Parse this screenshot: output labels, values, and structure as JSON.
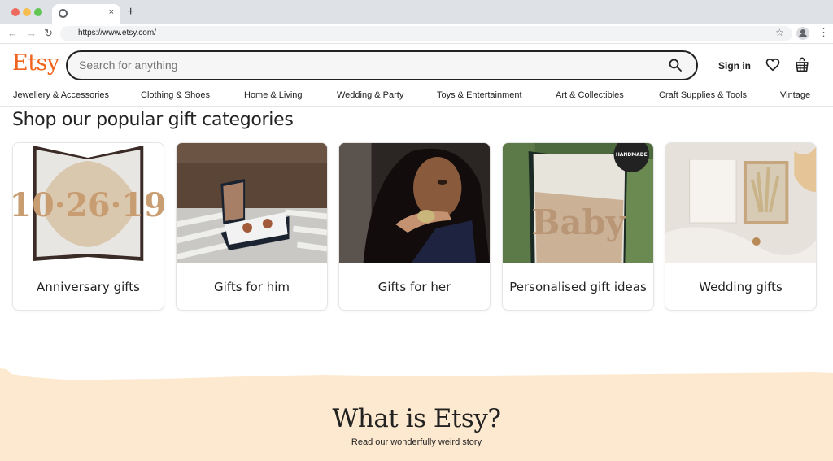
{
  "browser": {
    "tab_close": "×",
    "new_tab": "+",
    "url": "https://www.etsy.com/",
    "back": "←",
    "forward": "→",
    "reload": "↻",
    "bookmark": "☆",
    "menu": "⋮"
  },
  "header": {
    "logo": "Etsy",
    "logo_color": "#f1641e",
    "search_placeholder": "Search for anything",
    "search_value": "",
    "sign_in": "Sign in"
  },
  "categories_nav": [
    "Jewellery & Accessories",
    "Clothing & Shoes",
    "Home & Living",
    "Wedding & Party",
    "Toys & Entertainment",
    "Art & Collectibles",
    "Craft Supplies & Tools",
    "Vintage"
  ],
  "gift_section": {
    "title": "Shop our popular gift categories",
    "cards": [
      {
        "label": "Anniversary gifts",
        "image": "folded book art spelling 10-26-19"
      },
      {
        "label": "Gifts for him",
        "image": "wooden cufflinks in a box"
      },
      {
        "label": "Gifts for her",
        "image": "woman wearing a gold ring"
      },
      {
        "label": "Personalised gift ideas",
        "image": "folded book art spelling Baby",
        "badge": "HANDMADE"
      },
      {
        "label": "Wedding gifts",
        "image": "card and dried flower gift box"
      }
    ]
  },
  "about": {
    "title": "What is Etsy?",
    "link": "Read our wonderfully weird story",
    "bg_color": "#fde9cf"
  }
}
